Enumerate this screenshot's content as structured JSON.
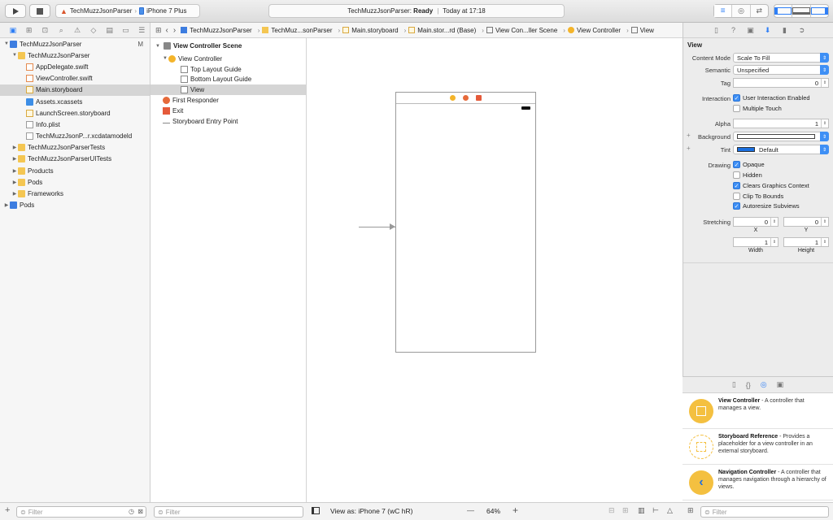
{
  "toolbar": {
    "scheme_target": "TechMuzzJsonParser",
    "scheme_device": "iPhone 7 Plus",
    "status_project": "TechMuzzJsonParser:",
    "status_state": "Ready",
    "status_sep": "|",
    "status_time": "Today at 17:18"
  },
  "navigator": {
    "items": [
      {
        "label": "TechMuzzJsonParser",
        "badge": "M",
        "depth": 0,
        "icon": "project-icon",
        "expanded": true
      },
      {
        "label": "TechMuzzJsonParser",
        "depth": 1,
        "icon": "folder-icon",
        "expanded": true
      },
      {
        "label": "AppDelegate.swift",
        "depth": 2,
        "icon": "swift-file-icon"
      },
      {
        "label": "ViewController.swift",
        "depth": 2,
        "icon": "swift-file-icon"
      },
      {
        "label": "Main.storyboard",
        "depth": 2,
        "icon": "storyboard-icon",
        "selected": true
      },
      {
        "label": "Assets.xcassets",
        "depth": 2,
        "icon": "assets-icon"
      },
      {
        "label": "LaunchScreen.storyboard",
        "depth": 2,
        "icon": "storyboard-icon"
      },
      {
        "label": "Info.plist",
        "depth": 2,
        "icon": "plist-icon"
      },
      {
        "label": "TechMuzzJsonP...r.xcdatamodeld",
        "depth": 2,
        "icon": "datamodel-icon"
      },
      {
        "label": "TechMuzzJsonParserTests",
        "depth": 1,
        "icon": "folder-icon",
        "collapsed": true
      },
      {
        "label": "TechMuzzJsonParserUITests",
        "depth": 1,
        "icon": "folder-icon",
        "collapsed": true
      },
      {
        "label": "Products",
        "depth": 1,
        "icon": "folder-icon",
        "collapsed": true
      },
      {
        "label": "Pods",
        "depth": 1,
        "icon": "folder-icon",
        "collapsed": true
      },
      {
        "label": "Frameworks",
        "depth": 1,
        "icon": "folder-icon",
        "collapsed": true
      },
      {
        "label": "Pods",
        "depth": 0,
        "icon": "project-icon",
        "collapsed": true
      }
    ],
    "filter_placeholder": "Filter"
  },
  "jumpbar": {
    "crumbs": [
      "TechMuzzJsonParser",
      "TechMuz...sonParser",
      "Main.storyboard",
      "Main.stor...rd (Base)",
      "View Con...ller Scene",
      "View Controller",
      "View"
    ]
  },
  "outline": {
    "scene": "View Controller Scene",
    "items": [
      {
        "label": "View Controller",
        "depth": 1
      },
      {
        "label": "Top Layout Guide",
        "depth": 2
      },
      {
        "label": "Bottom Layout Guide",
        "depth": 2
      },
      {
        "label": "View",
        "depth": 2,
        "selected": true
      },
      {
        "label": "First Responder",
        "depth": 0
      },
      {
        "label": "Exit",
        "depth": 0
      },
      {
        "label": "Storyboard Entry Point",
        "depth": 0
      }
    ],
    "filter_placeholder": "Filter"
  },
  "canvas": {
    "view_as": "View as: iPhone 7 (wC hR)",
    "zoom": "64%",
    "zoom_out": "—",
    "zoom_in": "+"
  },
  "inspector": {
    "section": "View",
    "content_mode_label": "Content Mode",
    "content_mode": "Scale To Fill",
    "semantic_label": "Semantic",
    "semantic": "Unspecified",
    "tag_label": "Tag",
    "tag": "0",
    "interaction_label": "Interaction",
    "user_interaction": "User Interaction Enabled",
    "multiple_touch": "Multiple Touch",
    "alpha_label": "Alpha",
    "alpha": "1",
    "background_label": "Background",
    "tint_label": "Tint",
    "tint": "Default",
    "tint_color": "#1a6fe0",
    "drawing_label": "Drawing",
    "opaque": "Opaque",
    "hidden": "Hidden",
    "clears_graphics": "Clears Graphics Context",
    "clip_to_bounds": "Clip To Bounds",
    "autoresize": "Autoresize Subviews",
    "stretching_label": "Stretching",
    "stretch_x": "0",
    "stretch_y": "0",
    "stretch_w": "1",
    "stretch_h": "1",
    "x_label": "X",
    "y_label": "Y",
    "width_label": "Width",
    "height_label": "Height",
    "plus": "+",
    "checks": {
      "user_interaction": true,
      "multiple_touch": false,
      "opaque": true,
      "hidden": false,
      "clears_graphics": true,
      "clip_to_bounds": false,
      "autoresize": true
    }
  },
  "library": {
    "items": [
      {
        "title": "View Controller",
        "desc": " - A controller that manages a view."
      },
      {
        "title": "Storyboard Reference",
        "desc": " - Provides a placeholder for a view controller in an external storyboard."
      },
      {
        "title": "Navigation Controller",
        "desc": " - A controller that manages navigation through a hierarchy of views."
      }
    ],
    "filter_placeholder": "Filter"
  }
}
